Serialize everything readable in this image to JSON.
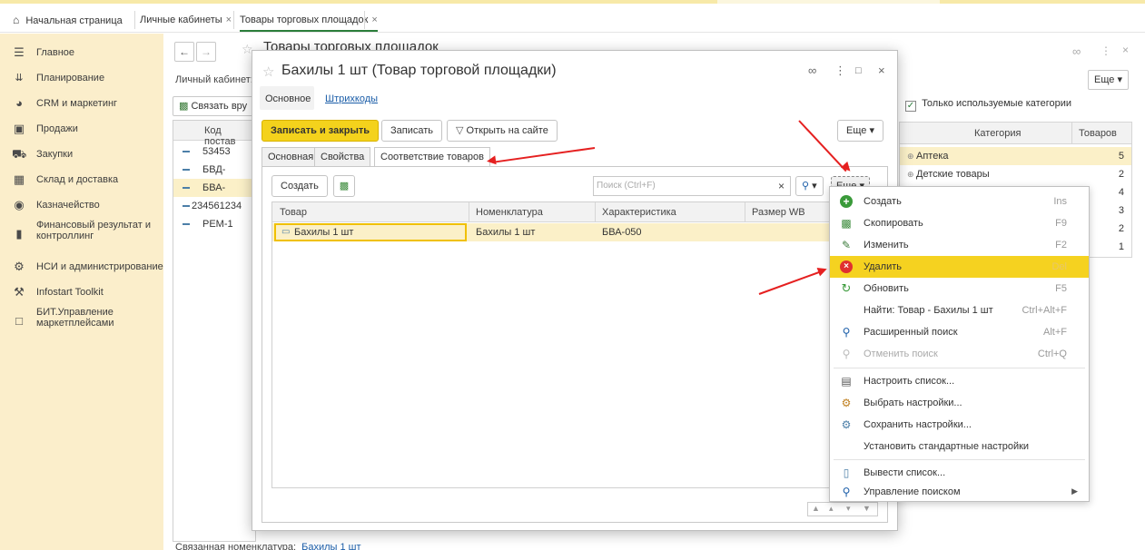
{
  "tabs": {
    "home": "Начальная страница",
    "cabinets": "Личные кабинеты",
    "goods": "Товары торговых площадок",
    "close": "×"
  },
  "sidebar": {
    "items": [
      {
        "label": "Главное",
        "icon": "menu-icon"
      },
      {
        "label": "Планирование",
        "icon": "planning-icon"
      },
      {
        "label": "CRM и маркетинг",
        "icon": "crm-icon"
      },
      {
        "label": "Продажи",
        "icon": "sales-icon"
      },
      {
        "label": "Закупки",
        "icon": "cart-icon"
      },
      {
        "label": "Склад и доставка",
        "icon": "warehouse-icon"
      },
      {
        "label": "Казначейство",
        "icon": "treasury-icon"
      },
      {
        "label": "Финансовый результат и контроллинг",
        "icon": "chart-icon"
      },
      {
        "label": "НСИ и администрирование",
        "icon": "gear-icon"
      },
      {
        "label": "Infostart Toolkit",
        "icon": "tools-icon"
      },
      {
        "label": "БИТ.Управление маркетплейсами",
        "icon": "chat-icon"
      }
    ]
  },
  "background": {
    "title": "Товары торговых площадок",
    "cabinet_label": "Личный кабинет:",
    "link_button": "Связать вру",
    "col_code": "Код постав",
    "rows": [
      "53453",
      "БВД-",
      "БВА-",
      "234561234",
      "РЕМ-1"
    ],
    "related_label": "Связанная номенклатура:",
    "related_link": "Бахилы 1 шт",
    "more": "Еще",
    "only_used": "Только используемые категории",
    "cat_header": "Категория",
    "count_header": "Товаров",
    "categories": [
      {
        "name": "Аптека",
        "count": "5"
      },
      {
        "name": "Детские товары",
        "count": "2"
      },
      {
        "name": "",
        "count": "4"
      },
      {
        "name": "",
        "count": "3"
      },
      {
        "name": "",
        "count": "2"
      },
      {
        "name": "",
        "count": "1"
      }
    ]
  },
  "modal": {
    "title": "Бахилы 1 шт (Товар торговой площадки)",
    "nav_main": "Основное",
    "nav_barcodes": "Штрихкоды",
    "save_close": "Записать и закрыть",
    "save": "Записать",
    "open_site": "Открыть на сайте",
    "more": "Еще",
    "inner_tabs": [
      "Основная",
      "Свойства",
      "Соответствие товаров"
    ],
    "create": "Создать",
    "search_placeholder": "Поиск (Ctrl+F)",
    "columns": [
      "Товар",
      "Номенклатура",
      "Характеристика",
      "Размер WB"
    ],
    "row": {
      "product": "Бахилы 1 шт",
      "nomenclature": "Бахилы 1 шт",
      "characteristic": "БВА-050",
      "size": ""
    }
  },
  "dropdown": {
    "items": [
      {
        "label": "Создать",
        "key": "Ins",
        "icon": "plus-circle-icon"
      },
      {
        "label": "Скопировать",
        "key": "F9",
        "icon": "copy-icon"
      },
      {
        "label": "Изменить",
        "key": "F2",
        "icon": "pencil-icon"
      },
      {
        "label": "Удалить",
        "key": "Del",
        "icon": "delete-icon"
      },
      {
        "label": "Обновить",
        "key": "F5",
        "icon": "refresh-icon"
      },
      {
        "label": "Найти: Товар - Бахилы 1 шт",
        "key": "Ctrl+Alt+F",
        "icon": ""
      },
      {
        "label": "Расширенный поиск",
        "key": "Alt+F",
        "icon": "advanced-search-icon"
      },
      {
        "label": "Отменить поиск",
        "key": "Ctrl+Q",
        "icon": "cancel-search-icon"
      },
      {
        "label": "Настроить список...",
        "key": "",
        "icon": "settings-list-icon"
      },
      {
        "label": "Выбрать настройки...",
        "key": "",
        "icon": "choose-settings-icon"
      },
      {
        "label": "Сохранить настройки...",
        "key": "",
        "icon": "save-settings-icon"
      },
      {
        "label": "Установить стандартные настройки",
        "key": "",
        "icon": ""
      },
      {
        "label": "Вывести список...",
        "key": "",
        "icon": "export-list-icon"
      },
      {
        "label": "Управление поиском",
        "key": "",
        "icon": "search-manage-icon"
      }
    ]
  },
  "colors": {
    "accent": "#f5d220",
    "sidebar": "#fbeecb",
    "arrow": "#e52020",
    "link": "#1a5da8"
  }
}
